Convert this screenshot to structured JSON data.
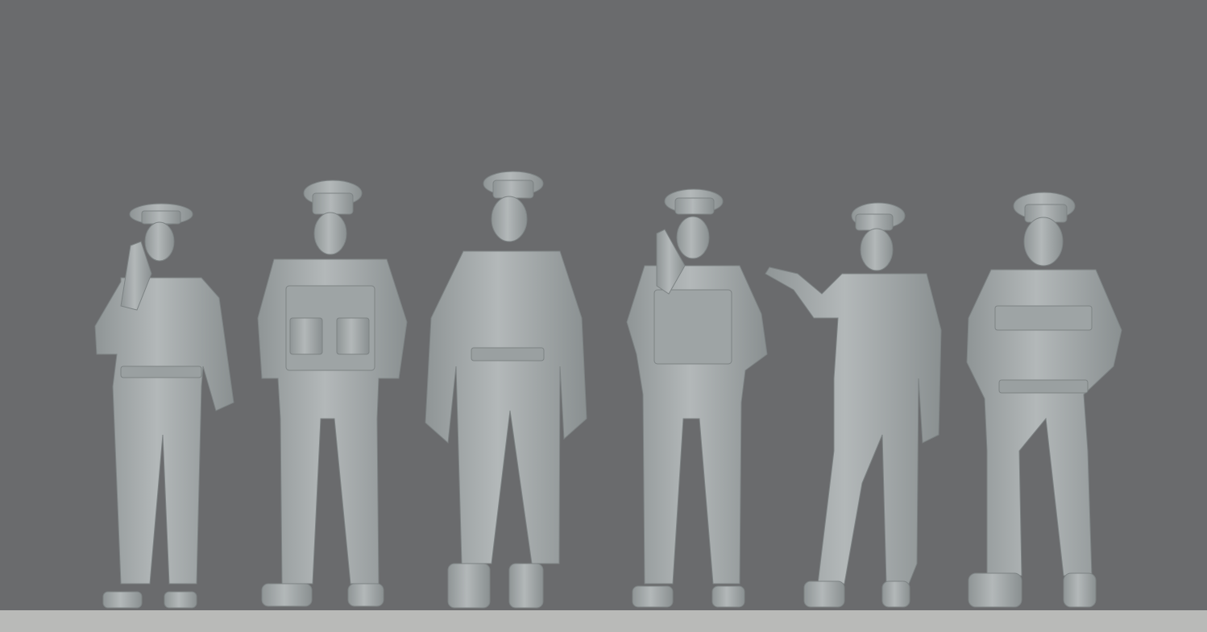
{
  "scene": {
    "background_color": "#6a6b6d",
    "floor_color": "#b9bab8",
    "figure_color": "#a3a8a9",
    "figures": [
      {
        "id": "figure-1",
        "pose": "radio-to-mouth"
      },
      {
        "id": "figure-2",
        "pose": "tactical-vest-standing"
      },
      {
        "id": "figure-3",
        "pose": "standing-arms-down"
      },
      {
        "id": "figure-4",
        "pose": "radio-to-mouth-vest"
      },
      {
        "id": "figure-5",
        "pose": "pointing-left"
      },
      {
        "id": "figure-6",
        "pose": "hands-on-belt"
      }
    ]
  }
}
